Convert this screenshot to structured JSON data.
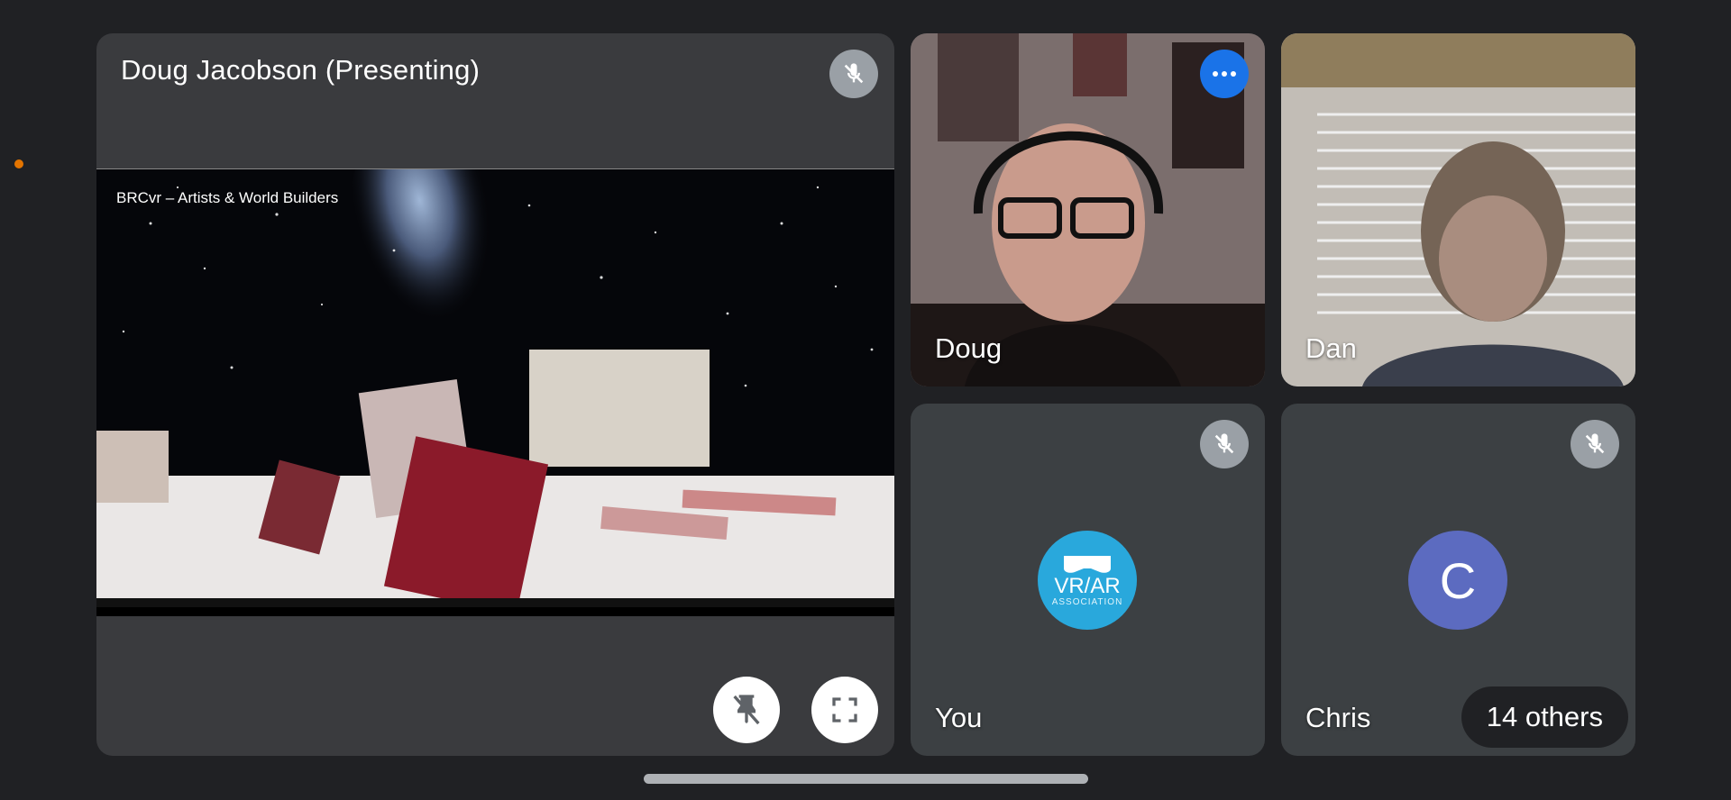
{
  "presenter_tile": {
    "title": "Doug Jacobson (Presenting)",
    "screen_caption": "BRCvr – Artists & World Builders",
    "pin_icon": "unpin-icon",
    "fullscreen_icon": "fullscreen-icon",
    "mic_icon": "mic-off-icon"
  },
  "participants": {
    "doug": {
      "name": "Doug",
      "menu_icon": "more-horizontal-icon"
    },
    "dan": {
      "name": "Dan"
    },
    "you": {
      "name": "You",
      "avatar_text": "VR/AR",
      "avatar_subtext": "ASSOCIATION",
      "mic_icon": "mic-off-icon"
    },
    "chris": {
      "name": "Chris",
      "avatar_letter": "C",
      "mic_icon": "mic-off-icon"
    }
  },
  "others_count_label": "14 others",
  "colors": {
    "background": "#202124",
    "tile": "#3c4043",
    "accent_blue": "#1a73e8",
    "chris_avatar": "#5c6bc0",
    "you_avatar": "#29a8dc",
    "status_dot": "#e37400"
  }
}
